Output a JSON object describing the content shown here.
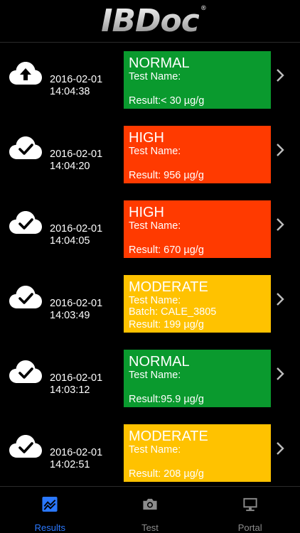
{
  "app": {
    "logo_text": "IBDoc",
    "logo_mark": "®"
  },
  "colors": {
    "normal": "#0a9a2e",
    "high": "#ff3a00",
    "moderate": "#ffc200",
    "tab_active": "#2a78ff",
    "tab_inactive": "#8c8c8c"
  },
  "results": [
    {
      "status": "upload",
      "date": "2016-02-01",
      "time": "14:04:38",
      "level": "NORMAL",
      "level_key": "normal",
      "test_name": "Test Name:",
      "batch": "",
      "result": "Result:< 30 µg/g"
    },
    {
      "status": "synced",
      "date": "2016-02-01",
      "time": "14:04:20",
      "level": "HIGH",
      "level_key": "high",
      "test_name": "Test Name:",
      "batch": "",
      "result": "Result: 956 µg/g"
    },
    {
      "status": "synced",
      "date": "2016-02-01",
      "time": "14:04:05",
      "level": "HIGH",
      "level_key": "high",
      "test_name": "Test Name:",
      "batch": "",
      "result": "Result: 670 µg/g"
    },
    {
      "status": "synced",
      "date": "2016-02-01",
      "time": "14:03:49",
      "level": "MODERATE",
      "level_key": "moderate",
      "test_name": "Test Name:",
      "batch": "Batch: CALE_3805",
      "result": "Result: 199 µg/g"
    },
    {
      "status": "synced",
      "date": "2016-02-01",
      "time": "14:03:12",
      "level": "NORMAL",
      "level_key": "normal",
      "test_name": "Test Name:",
      "batch": "",
      "result": "Result:95.9 µg/g"
    },
    {
      "status": "synced",
      "date": "2016-02-01",
      "time": "14:02:51",
      "level": "MODERATE",
      "level_key": "moderate",
      "test_name": "Test Name:",
      "batch": "",
      "result": "Result: 208 µg/g"
    }
  ],
  "tabs": [
    {
      "label": "Results",
      "icon": "chart-icon",
      "active": true
    },
    {
      "label": "Test",
      "icon": "camera-icon",
      "active": false
    },
    {
      "label": "Portal",
      "icon": "monitor-icon",
      "active": false
    }
  ]
}
